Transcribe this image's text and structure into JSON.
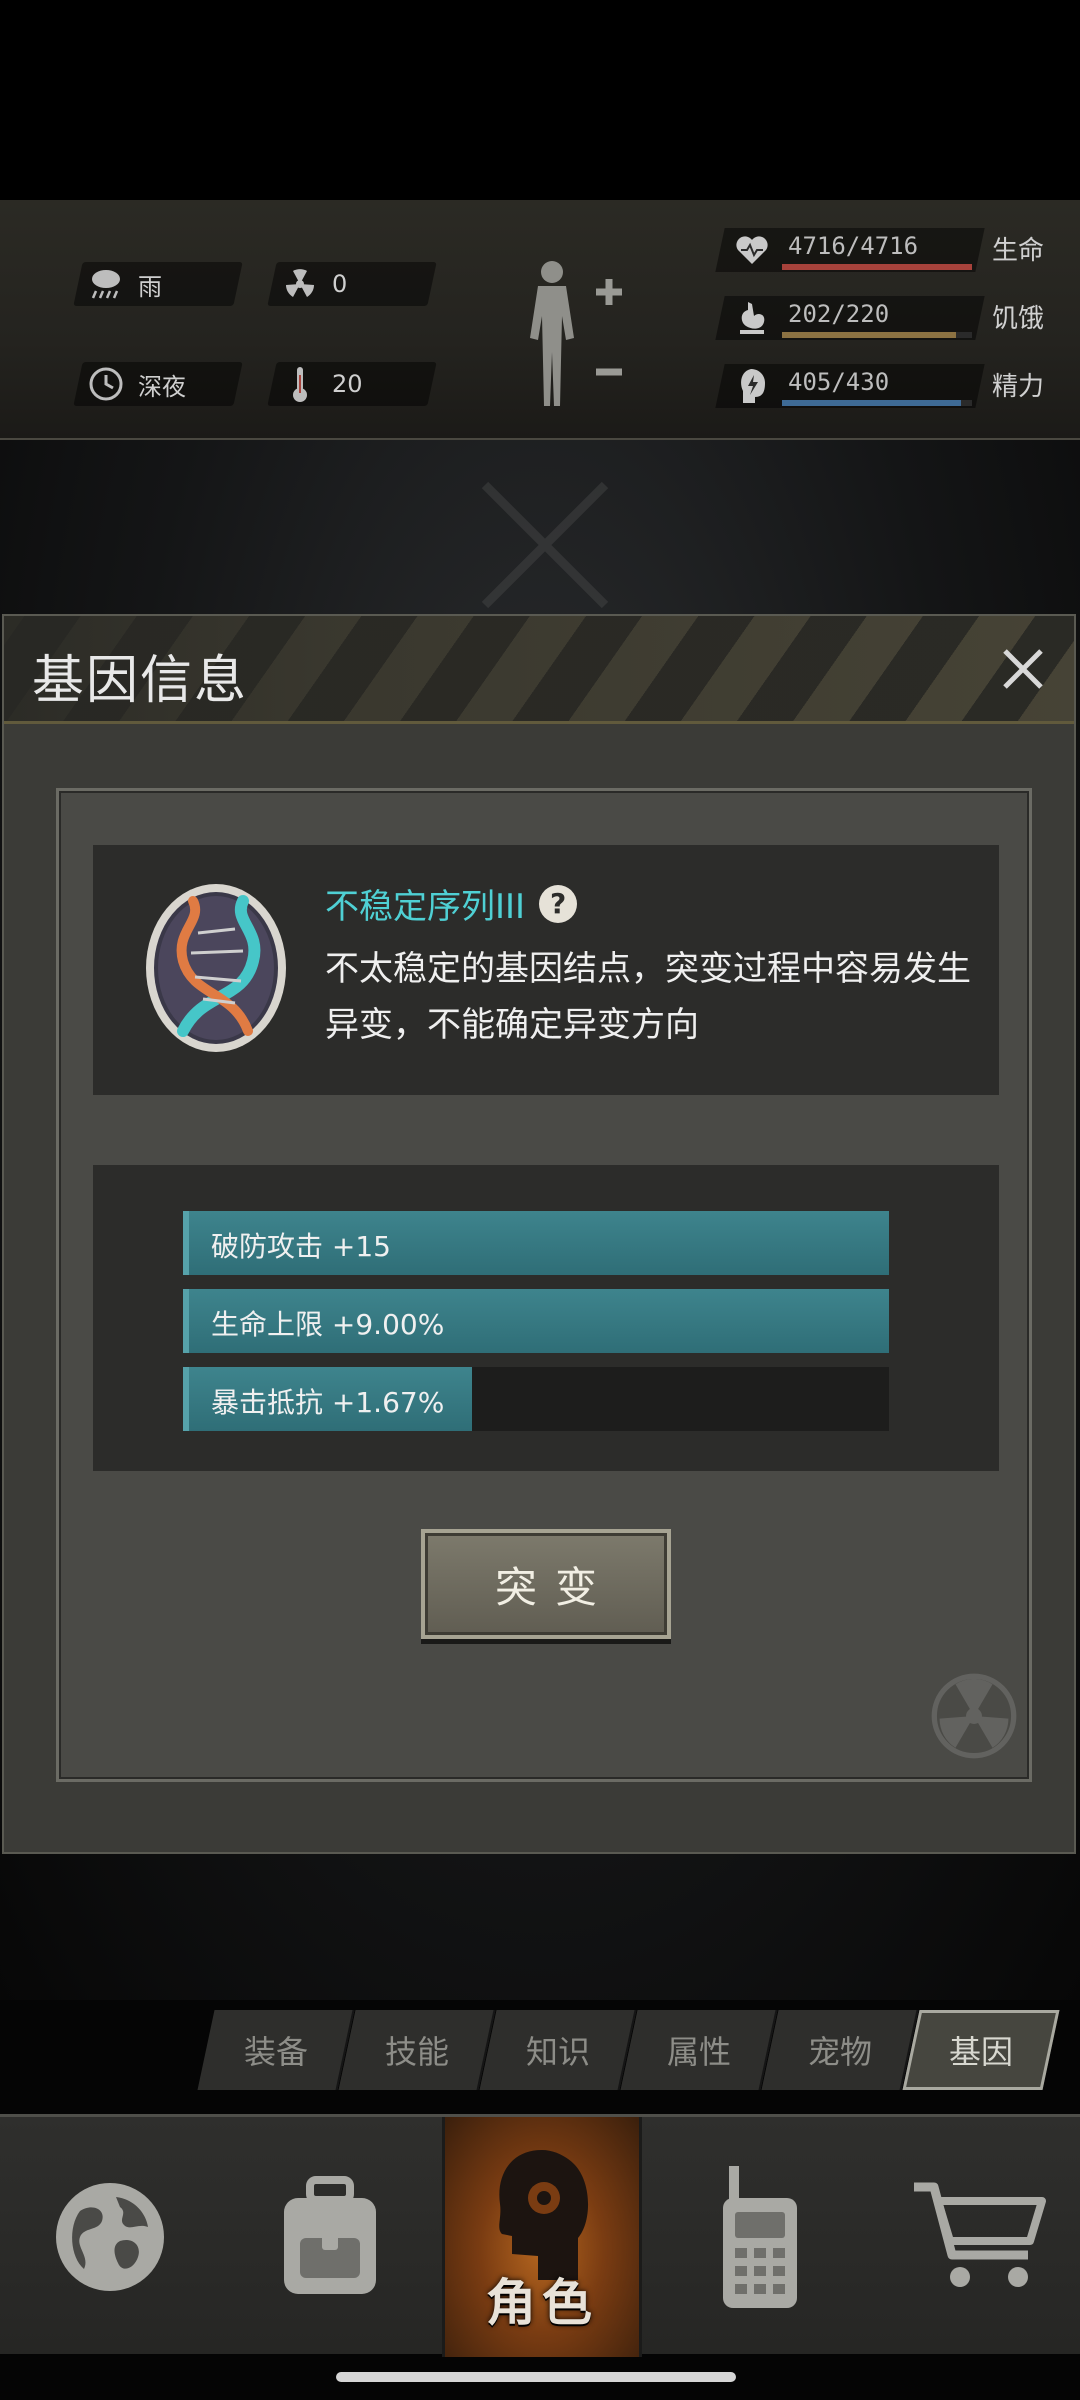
{
  "status": {
    "weather": "雨",
    "radiation": "0",
    "time_of_day": "深夜",
    "temperature": "20",
    "stats": [
      {
        "icon": "heart-icon",
        "value": "4716/4716",
        "label": "生命",
        "level": 1.0,
        "color": "#a7423b"
      },
      {
        "icon": "stomach-icon",
        "value": "202/220",
        "label": "饥饿",
        "level": 0.918,
        "color": "#8c7242"
      },
      {
        "icon": "energy-icon",
        "value": "405/430",
        "label": "精力",
        "level": 0.942,
        "color": "#3e6a95"
      }
    ]
  },
  "dialog": {
    "title": "基因信息",
    "gene": {
      "name": "不稳定序列III",
      "description": "不太稳定的基因结点，突变过程中容易发生异变，不能确定异变方向"
    },
    "attributes": [
      {
        "label": "破防攻击 +15",
        "level": 1.0
      },
      {
        "label": "生命上限 +9.00%",
        "level": 1.0
      },
      {
        "label": "暴击抵抗 +1.67%",
        "level": 0.41
      }
    ],
    "mutate_label": "突变"
  },
  "tabs": [
    {
      "label": "装备",
      "active": false
    },
    {
      "label": "技能",
      "active": false
    },
    {
      "label": "知识",
      "active": false
    },
    {
      "label": "属性",
      "active": false
    },
    {
      "label": "宠物",
      "active": false
    },
    {
      "label": "基因",
      "active": true
    }
  ],
  "nav": {
    "items": [
      "globe-icon",
      "backpack-icon",
      "character-head-icon",
      "walkie-talkie-icon",
      "shopping-cart-icon"
    ],
    "active_label": "角色"
  },
  "colors": {
    "accent_cyan": "#4fd0d4",
    "attribute_fill": "#3e848d",
    "nav_active": "#b5661f"
  }
}
